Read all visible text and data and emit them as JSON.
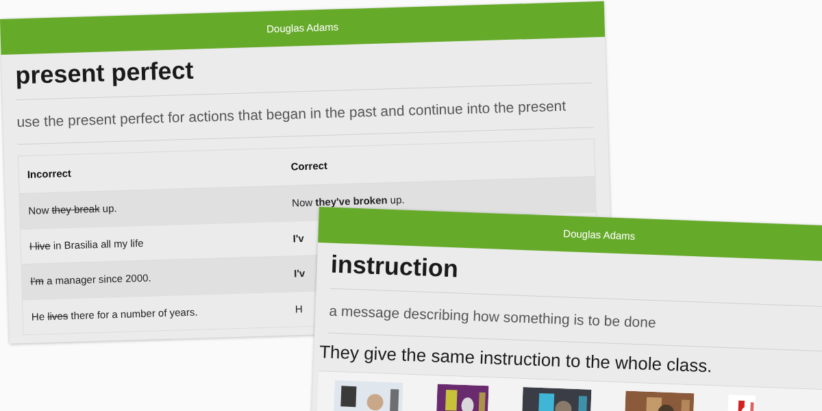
{
  "cards": [
    {
      "header": "Douglas Adams",
      "title": "present perfect",
      "subtitle": "use the present perfect for actions that began in the past and continue into the present",
      "kind": "table",
      "table": {
        "columns": [
          "Incorrect",
          "Correct"
        ],
        "rows": [
          {
            "cells": [
              [
                {
                  "text": "Now ",
                  "kind": "plain"
                },
                {
                  "text": "they break",
                  "kind": "struck"
                },
                {
                  "text": " up.",
                  "kind": "plain"
                }
              ],
              [
                {
                  "text": "Now ",
                  "kind": "plain"
                },
                {
                  "text": "they've broken",
                  "kind": "bold"
                },
                {
                  "text": " up.",
                  "kind": "plain"
                }
              ]
            ]
          },
          {
            "cells": [
              [
                {
                  "text": "I live",
                  "kind": "struck"
                },
                {
                  "text": " in Brasilia all my life",
                  "kind": "plain"
                }
              ],
              [
                {
                  "text": "I'v",
                  "kind": "bold"
                }
              ]
            ]
          },
          {
            "cells": [
              [
                {
                  "text": "I'm",
                  "kind": "struck"
                },
                {
                  "text": " a manager since 2000.",
                  "kind": "plain"
                }
              ],
              [
                {
                  "text": "I'v",
                  "kind": "bold"
                }
              ]
            ]
          },
          {
            "cells": [
              [
                {
                  "text": "He ",
                  "kind": "plain"
                },
                {
                  "text": "lives",
                  "kind": "struck"
                },
                {
                  "text": " there for a number of years.",
                  "kind": "plain"
                }
              ],
              [
                {
                  "text": "H",
                  "kind": "plain"
                }
              ]
            ]
          }
        ]
      }
    },
    {
      "header": "Douglas Adams",
      "title": "instruction",
      "subtitle": "a message describing how something is to be done",
      "kind": "example",
      "example": "They give the same instruction to the whole class."
    }
  ]
}
